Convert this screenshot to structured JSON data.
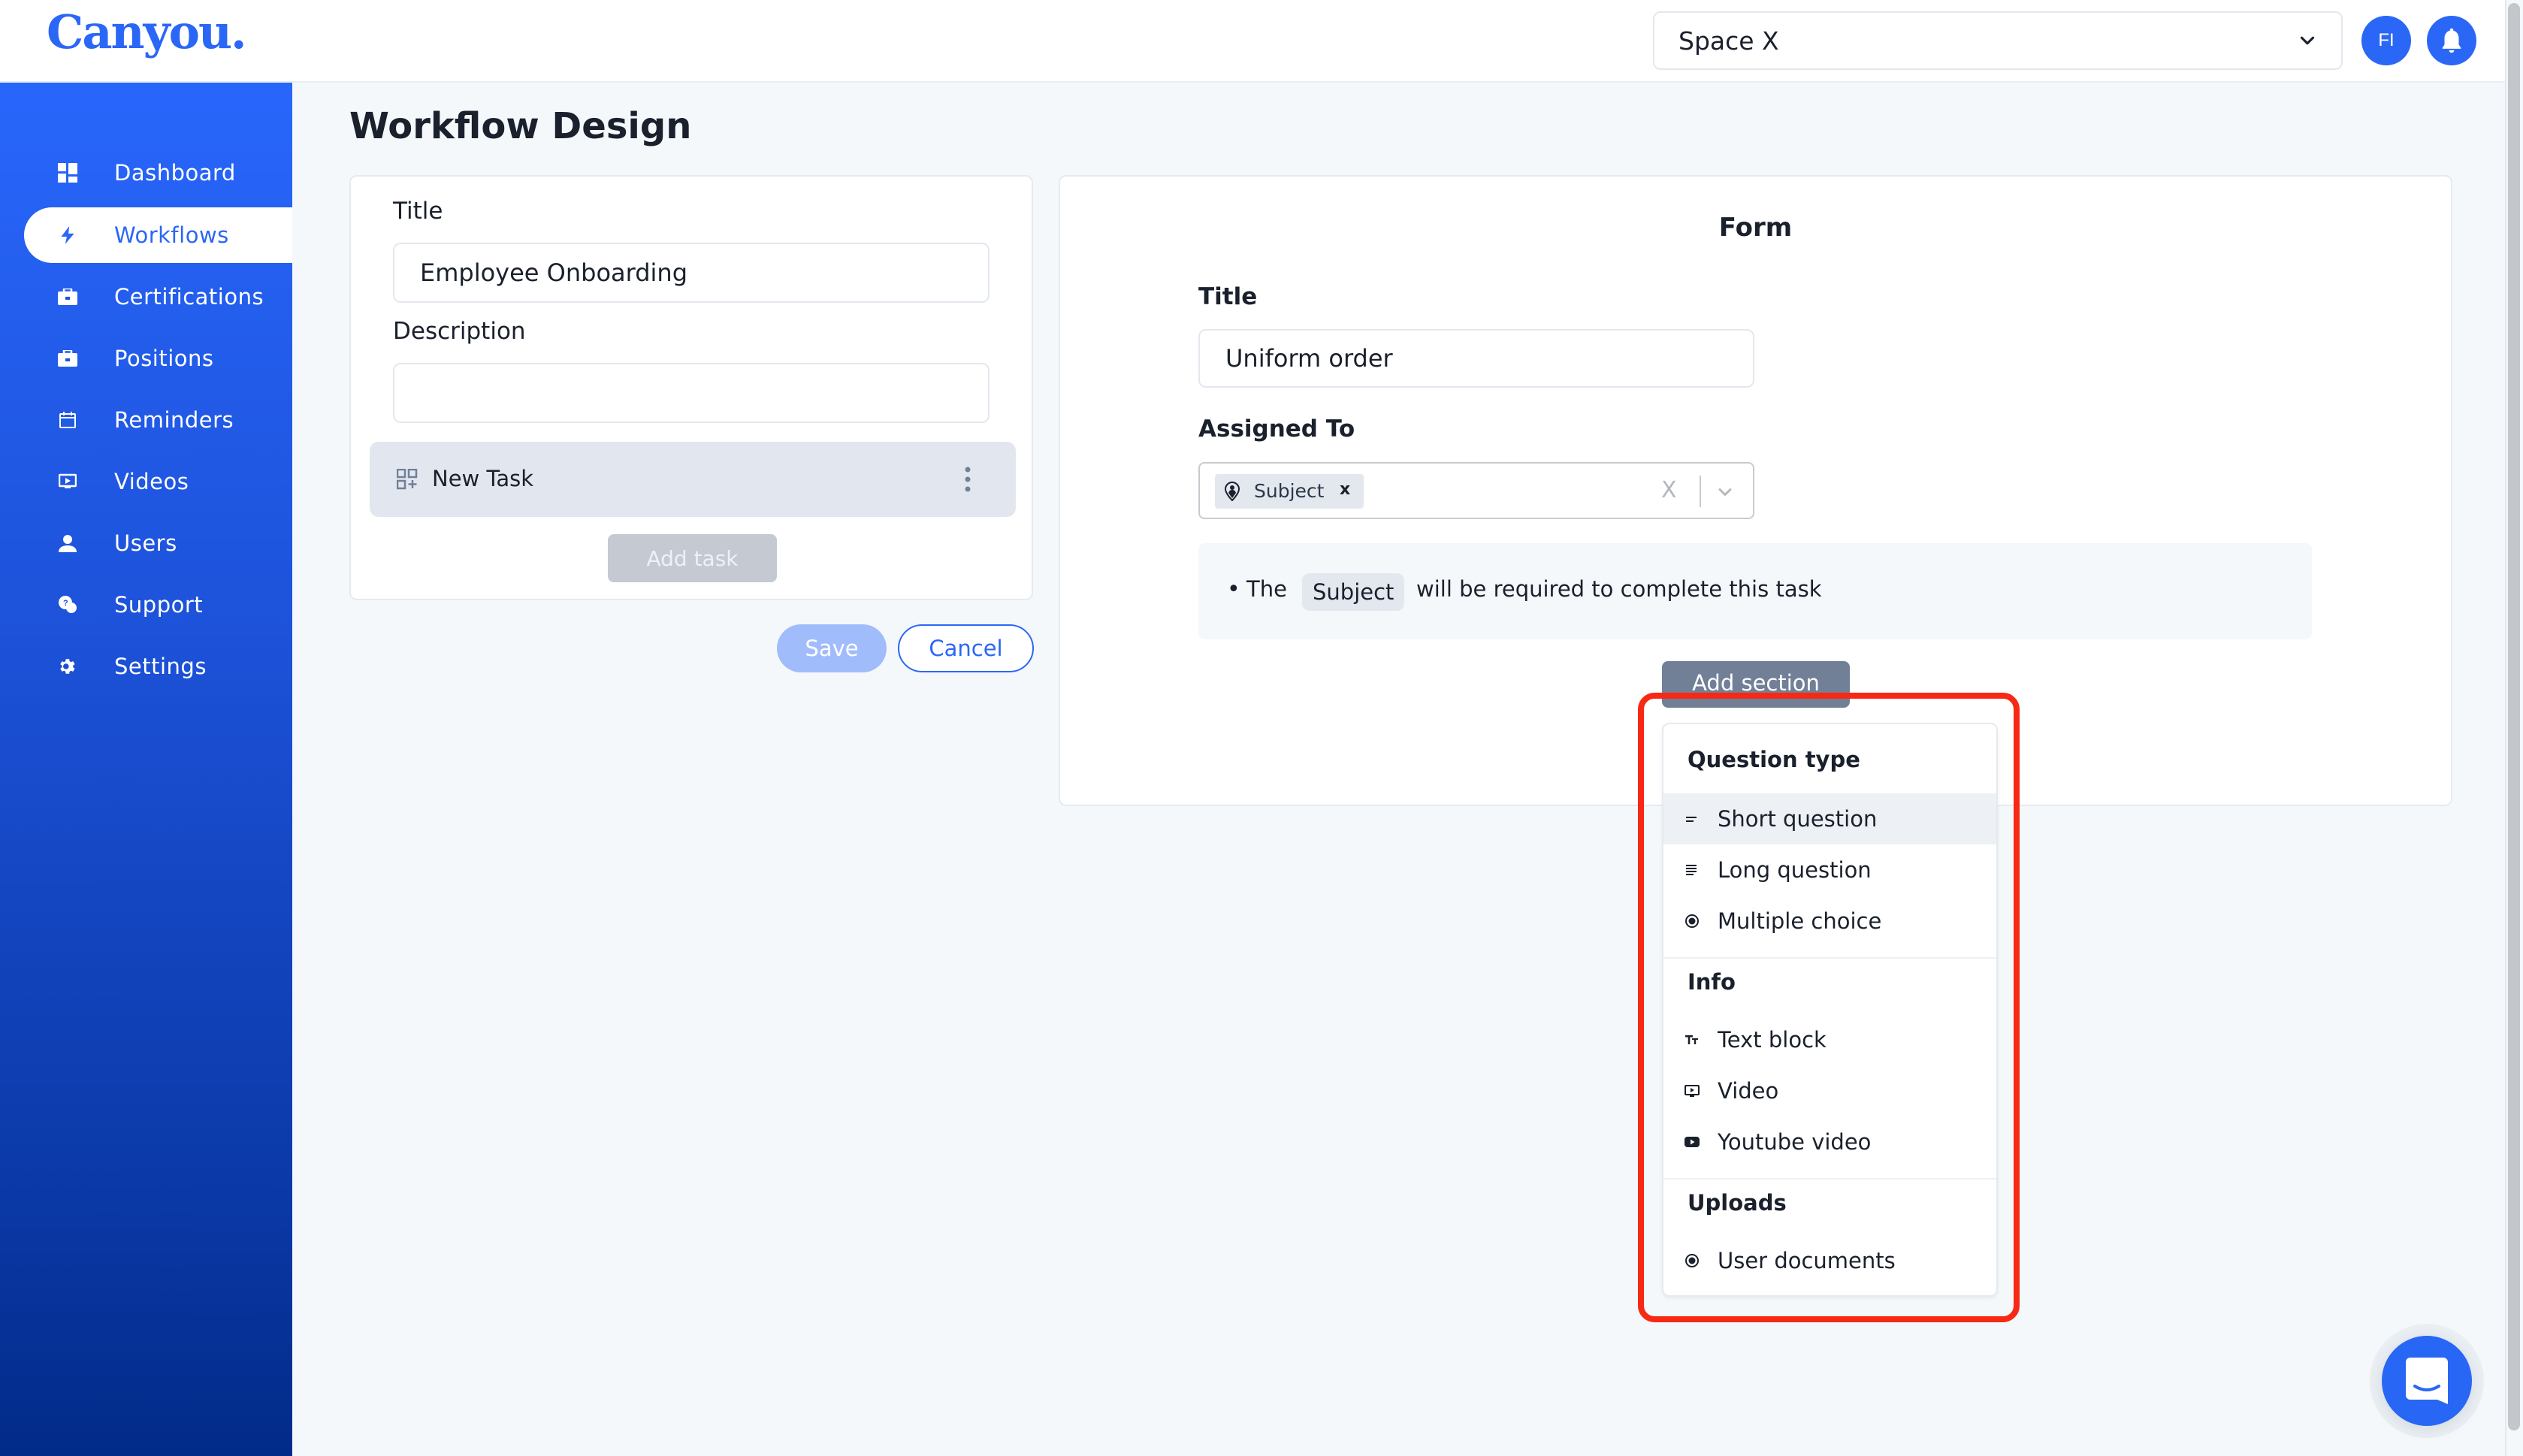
{
  "app": {
    "logo_text": "Canyou.",
    "brand_color": "#2b67f6"
  },
  "header": {
    "workspace_select": {
      "value": "Space X",
      "icon": "chevron-down-icon"
    },
    "avatar_initials": "FI",
    "notifications_icon": "bell-icon"
  },
  "sidebar": {
    "items": [
      {
        "label": "Dashboard",
        "icon": "dashboard-icon",
        "active": false
      },
      {
        "label": "Workflows",
        "icon": "lightning-icon",
        "active": true
      },
      {
        "label": "Certifications",
        "icon": "briefcase-icon",
        "active": false
      },
      {
        "label": "Positions",
        "icon": "briefcase-icon",
        "active": false
      },
      {
        "label": "Reminders",
        "icon": "calendar-icon",
        "active": false
      },
      {
        "label": "Videos",
        "icon": "video-icon",
        "active": false
      },
      {
        "label": "Users",
        "icon": "user-icon",
        "active": false
      },
      {
        "label": "Support",
        "icon": "support-chat-icon",
        "active": false
      },
      {
        "label": "Settings",
        "icon": "gear-icon",
        "active": false
      }
    ]
  },
  "page": {
    "title": "Workflow Design"
  },
  "workflow": {
    "title_label": "Title",
    "title_value": "Employee Onboarding",
    "description_label": "Description",
    "description_value": "",
    "tasks": [
      {
        "label": "New Task",
        "icon": "task-grid-add-icon",
        "menu_icon": "kebab-menu-icon"
      }
    ],
    "add_task_label": "Add task",
    "save_label": "Save",
    "cancel_label": "Cancel"
  },
  "form": {
    "heading": "Form",
    "title_label": "Title",
    "title_value": "Uniform order",
    "assigned_label": "Assigned To",
    "assigned_chips": [
      {
        "label": "Subject",
        "icon": "user-pin-icon",
        "remove": "x"
      }
    ],
    "clear_symbol": "X",
    "notice": {
      "bullet": "•",
      "prefix": "The",
      "highlight": "Subject",
      "suffix": "will be required to complete this task"
    },
    "add_section_label": "Add section"
  },
  "section_menu": {
    "groups": [
      {
        "label": "Question type",
        "items": [
          {
            "label": "Short question",
            "icon": "short-text-icon",
            "hovered": true
          },
          {
            "label": "Long question",
            "icon": "long-text-icon",
            "hovered": false
          },
          {
            "label": "Multiple choice",
            "icon": "radio-icon",
            "hovered": false
          }
        ]
      },
      {
        "label": "Info",
        "items": [
          {
            "label": "Text block",
            "icon": "text-size-icon"
          },
          {
            "label": "Video",
            "icon": "video-icon"
          },
          {
            "label": "Youtube video",
            "icon": "youtube-icon"
          }
        ]
      },
      {
        "label": "Uploads",
        "items": [
          {
            "label": "User documents",
            "icon": "radio-icon"
          }
        ]
      }
    ],
    "highlight_color": "#f72814"
  },
  "chat_widget": {
    "icon": "chat-bubble-icon"
  }
}
